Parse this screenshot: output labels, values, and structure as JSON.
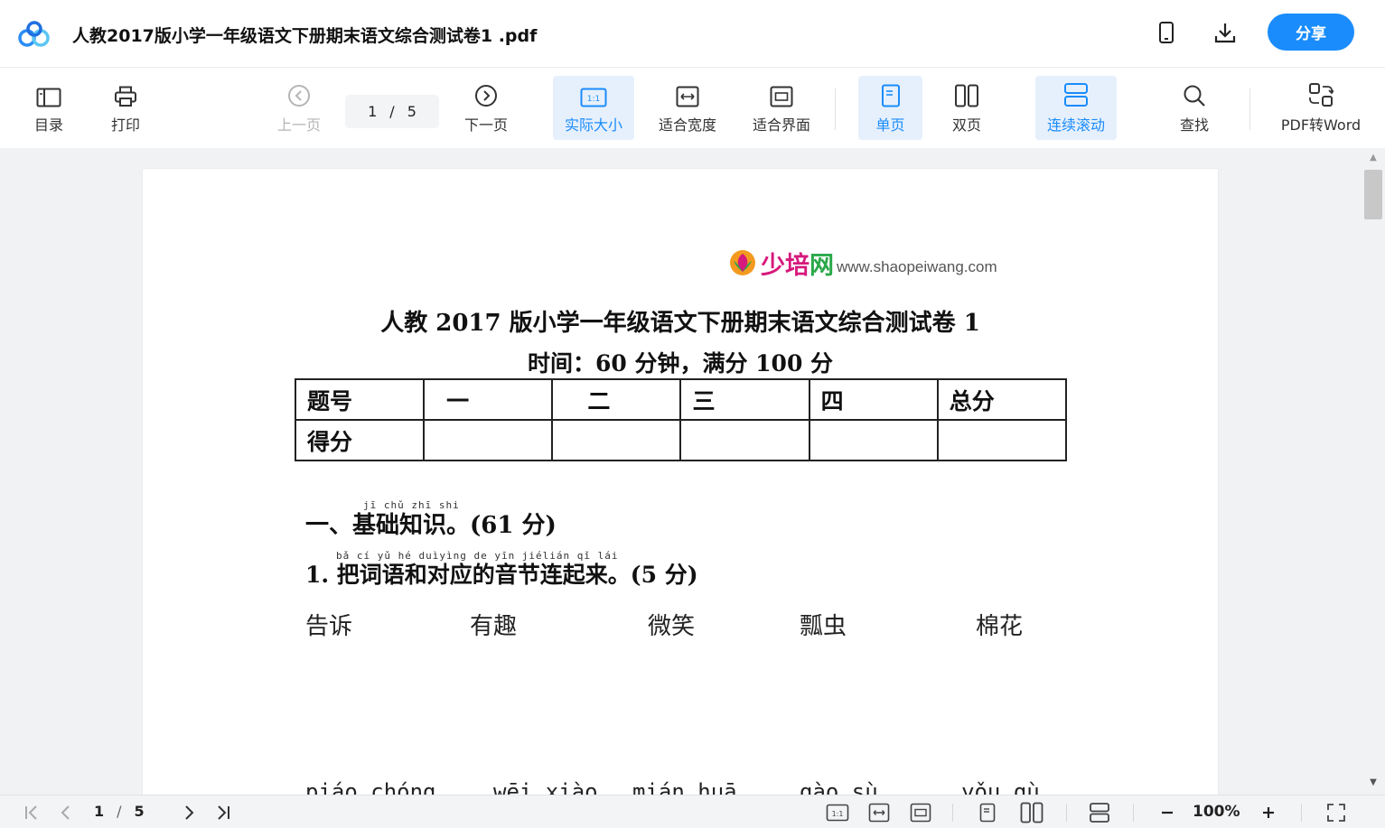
{
  "header": {
    "title": "人教2017版小学一年级语文下册期末语文综合测试卷1 .pdf",
    "share_label": "分享",
    "accent_color": "#1a8cfb"
  },
  "toolbar": {
    "toc_label": "目录",
    "print_label": "打印",
    "prev_label": "上一页",
    "current_page": "1",
    "page_sep": "/",
    "total_pages": "5",
    "next_label": "下一页",
    "actual_size_label": "实际大小",
    "fit_width_label": "适合宽度",
    "fit_page_label": "适合界面",
    "single_page_label": "单页",
    "double_page_label": "双页",
    "continuous_label": "连续滚动",
    "find_label": "查找",
    "pdf_to_word_label": "PDF转Word",
    "actual_size_icon_text": "1:1"
  },
  "document": {
    "site_name_a": "少培",
    "site_name_b": "网",
    "site_url": "www.shaopeiwang.com",
    "title": "人教 2017 版小学一年级语文下册期末语文综合测试卷 1",
    "subtitle": "时间：60 分钟，满分 100 分",
    "score_table": {
      "row1": [
        "题号",
        "一",
        "二",
        "三",
        "四",
        "总分"
      ],
      "row2": [
        "得分",
        "",
        "",
        "",
        "",
        ""
      ]
    },
    "section1_pinyin": "jī chǔ zhī shi",
    "section1": "一、基础知识。(61 分)",
    "q1_pinyin": "bǎ cí yǔ hé duìyìng de yīn jiélián qǐ lái",
    "q1": "1. 把词语和对应的音节连起来。(5 分)",
    "words": [
      "告诉",
      "有趣",
      "微笑",
      "瓢虫",
      "棉花"
    ],
    "pinyin_words": [
      "piáo chóng",
      "wēi xiào",
      "mián huā",
      "gào sù",
      "yǒu qù"
    ]
  },
  "bottombar": {
    "current_page": "1",
    "page_sep": "/",
    "total_pages": "5",
    "zoom": "100%",
    "actual_size_icon_text": "1:1"
  }
}
